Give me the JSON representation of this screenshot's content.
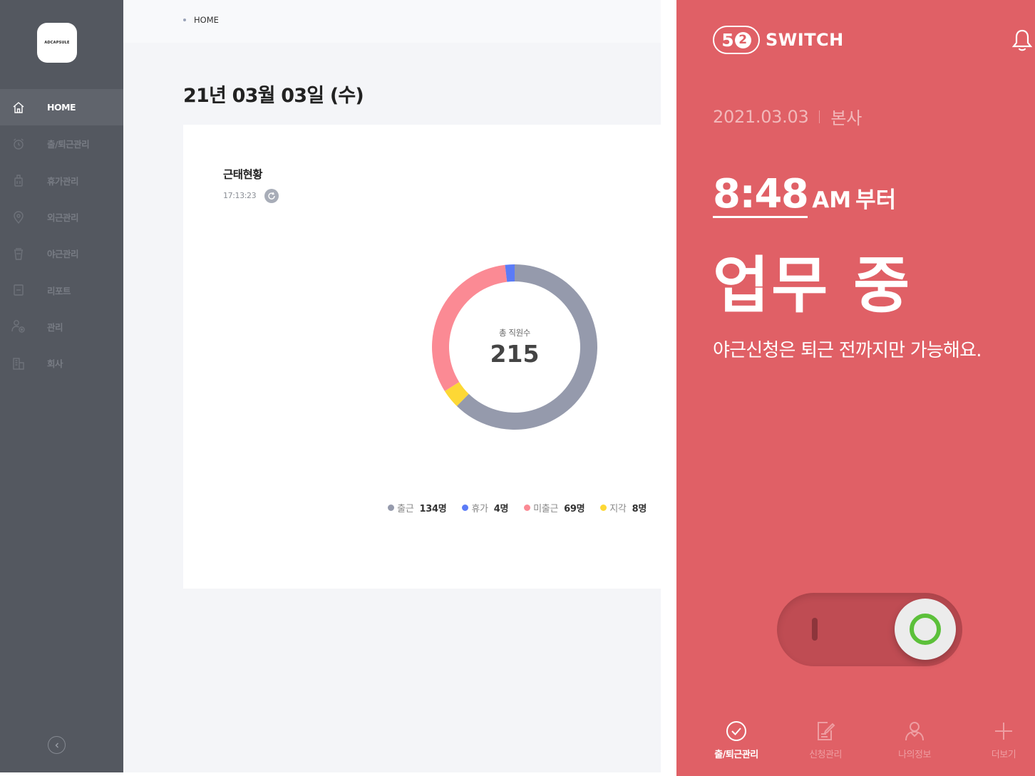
{
  "sidebar": {
    "logo_text": "ADCAPSULE",
    "items": [
      {
        "label": "HOME",
        "icon": "home-icon",
        "active": true
      },
      {
        "label": "출/퇴근관리",
        "icon": "alarm-clock-icon",
        "active": false
      },
      {
        "label": "휴가관리",
        "icon": "suitcase-icon",
        "active": false
      },
      {
        "label": "외근관리",
        "icon": "location-pin-icon",
        "active": false
      },
      {
        "label": "야근관리",
        "icon": "coffee-cup-icon",
        "active": false
      },
      {
        "label": "리포트",
        "icon": "report-icon",
        "active": false
      },
      {
        "label": "관리",
        "icon": "user-settings-icon",
        "active": false
      },
      {
        "label": "회사",
        "icon": "building-icon",
        "active": false
      }
    ]
  },
  "main": {
    "breadcrumb": "HOME",
    "date_title": "21년 03월 03일 (수)",
    "card": {
      "title": "근태현황",
      "time": "17:13:23",
      "center_label": "총 직원수",
      "center_value": "215"
    }
  },
  "chart_data": {
    "type": "pie",
    "categories": [
      "출근",
      "휴가",
      "미출근",
      "지각"
    ],
    "values": [
      134,
      4,
      69,
      8
    ],
    "units": [
      "명",
      "명",
      "명",
      "명"
    ],
    "colors": [
      "#959aac",
      "#5b7bf7",
      "#fb8a94",
      "#fdd835"
    ],
    "total": 215,
    "legend_position": "bottom-right"
  },
  "mobile": {
    "brand_five": "5",
    "brand_two": "2",
    "brand_name": "SWITCH",
    "date": "2021.03.03",
    "location": "본사",
    "time": "8:48",
    "ampm": "AM",
    "time_suffix": "부터",
    "status": "업무 중",
    "notice": "야근신청은 퇴근 전까지만 가능해요.",
    "toggle_on": true,
    "tabs": [
      {
        "label": "출/퇴근관리",
        "icon": "check-circle-icon",
        "active": true
      },
      {
        "label": "신청관리",
        "icon": "edit-document-icon",
        "active": false
      },
      {
        "label": "나의정보",
        "icon": "person-icon",
        "active": false
      },
      {
        "label": "더보기",
        "icon": "plus-icon",
        "active": false
      }
    ]
  }
}
